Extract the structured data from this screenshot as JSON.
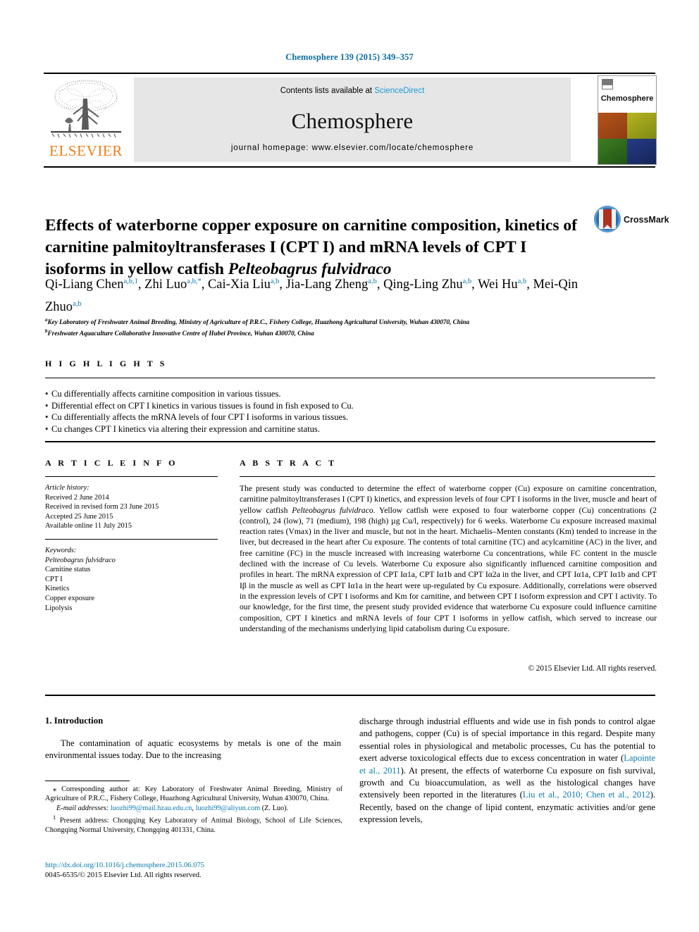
{
  "running_head": "Chemosphere 139 (2015) 349–357",
  "masthead": {
    "contents_prefix": "Contents lists available at ",
    "sciencedirect": "ScienceDirect",
    "journal_name": "Chemosphere",
    "homepage": "journal homepage: www.elsevier.com/locate/chemosphere",
    "publisher": "ELSEVIER",
    "cover_title": "Chemosphere",
    "accent_blue": "#1a9ad6",
    "publisher_orange": "#ef7d1a"
  },
  "article": {
    "title_line1": "Effects of waterborne copper exposure on carnitine composition, kinetics",
    "title_line2": "of carnitine palmitoyltransferases I (CPT I) and mRNA levels of CPT I",
    "title_line3_pre": "isoforms in yellow catfish ",
    "title_line3_italic": "Pelteobagrus fulvidraco",
    "crossmark_label": "CrossMark"
  },
  "authors": {
    "list": [
      {
        "name": "Qi-Liang Chen",
        "marks": "a,b,1",
        "sep": ", "
      },
      {
        "name": "Zhi Luo",
        "marks": "a,b,*",
        "sep": ", "
      },
      {
        "name": "Cai-Xia Liu",
        "marks": "a,b",
        "sep": ", "
      },
      {
        "name": "Jia-Lang Zheng",
        "marks": "a,b",
        "sep": ", "
      },
      {
        "name": "Qing-Ling Zhu",
        "marks": "a,b",
        "sep": ", "
      },
      {
        "name": "Wei Hu",
        "marks": "a,b",
        "sep": ", "
      },
      {
        "name": "Mei-Qin Zhuo",
        "marks": "a,b",
        "sep": ""
      }
    ],
    "affiliations": [
      {
        "mark": "a",
        "text": "Key Laboratory of Freshwater Animal Breeding, Ministry of Agriculture of P.R.C., Fishery College, Huazhong Agricultural University, Wuhan 430070, China"
      },
      {
        "mark": "b",
        "text": "Freshwater Aquaculture Collaborative Innovative Centre of Hubei Province, Wuhan 430070, China"
      }
    ]
  },
  "highlights": {
    "heading": "H I G H L I G H T S",
    "items": [
      "Cu differentially affects carnitine composition in various tissues.",
      "Differential effect on CPT I kinetics in various tissues is found in fish exposed to Cu.",
      "Cu differentially affects the mRNA levels of four CPT I isoforms in various tissues.",
      "Cu changes CPT I kinetics via altering their expression and carnitine status."
    ]
  },
  "article_info": {
    "heading": "A R T I C L E  I N F O",
    "history_label": "Article history:",
    "history": [
      "Received 2 June 2014",
      "Received in revised form 23 June 2015",
      "Accepted 25 June 2015",
      "Available online 11 July 2015"
    ],
    "keywords_label": "Keywords:",
    "keywords_italic": "Pelteobagrus fulvidraco",
    "keywords": [
      "Carnitine status",
      "CPT I",
      "Kinetics",
      "Copper exposure",
      "Lipolysis"
    ]
  },
  "abstract": {
    "heading": "A B S T R A C T",
    "part1": "The present study was conducted to determine the effect of waterborne copper (Cu) exposure on carnitine concentration, carnitine palmitoyltransferases I (CPT I) kinetics, and expression levels of four CPT I isoforms in the liver, muscle and heart of yellow catfish ",
    "species": "Pelteobagrus fulvidraco",
    "part2": ". Yellow catfish were exposed to four waterborne copper (Cu) concentrations (2 (control), 24 (low), 71 (medium), 198 (high) µg Cu/l, respectively) for 6 weeks. Waterborne Cu exposure increased maximal reaction rates (Vmax) in the liver and muscle, but not in the heart. Michaelis–Menten constants (Km) tended to increase in the liver, but decreased in the heart after Cu exposure. The contents of total carnitine (TC) and acylcarnitine (AC) in the liver, and free carnitine (FC) in the muscle increased with increasing waterborne Cu concentrations, while FC content in the muscle declined with the increase of Cu levels. Waterborne Cu exposure also significantly influenced carnitine composition and profiles in heart. The mRNA expression of CPT Iα1a, CPT Iα1b and CPT Iα2a in the liver, and CPT Iα1a, CPT Iα1b and CPT Iβ in the muscle as well as CPT Iα1a in the heart were up-regulated by Cu exposure. Additionally, correlations were observed in the expression levels of CPT I isoforms and Km for carnitine, and between CPT I isoform expression and CPT I activity. To our knowledge, for the first time, the present study provided evidence that waterborne Cu exposure could influence carnitine composition, CPT I kinetics and mRNA levels of four CPT I isoforms in yellow catfish, which served to increase our understanding of the mechanisms underlying lipid catabolism during Cu exposure.",
    "copyright": "© 2015 Elsevier Ltd. All rights reserved."
  },
  "introduction": {
    "section_number_title": "1. Introduction",
    "left_para": "The contamination of aquatic ecosystems by metals is one of the main environmental issues today. Due to the increasing",
    "right_para_a": "discharge through industrial effluents and wide use in fish ponds to control algae and pathogens, copper (Cu) is of special importance in this regard. Despite many essential roles in physiological and metabolic processes, Cu has the potential to exert adverse toxicological effects due to excess concentration in water (",
    "right_cite_1": "Lapointe et al., 2011",
    "right_para_b": "). At present, the effects of waterborne Cu exposure on fish survival, growth and Cu bioaccumulation, as well as the histological changes have extensively been reported in the literatures (",
    "right_cite_2": "Liu et al., 2010; Chen et al., 2012",
    "right_para_c": "). Recently, based on the change of lipid content, enzymatic activities and/or gene expression levels,"
  },
  "footnotes": {
    "corresponding": "Corresponding author at: Key Laboratory of Freshwater Animal Breeding, Ministry of Agriculture of P.R.C., Fishery College, Huazhong Agricultural University, Wuhan 430070, China.",
    "email_label": "E-mail addresses:",
    "email_1": "luozhi99@mail.hzau.edu.cn",
    "email_2": "luozhi99@aliyun.com",
    "email_suffix": "(Z. Luo).",
    "present_address": "Present address: Chongqing Key Laboratory of Animal Biology, School of Life Sciences, Chongqing Normal University, Chongqing 401331, China.",
    "doi": "http://dx.doi.org/10.1016/j.chemosphere.2015.06.075",
    "issn_line": "0045-6535/© 2015 Elsevier Ltd. All rights reserved."
  }
}
